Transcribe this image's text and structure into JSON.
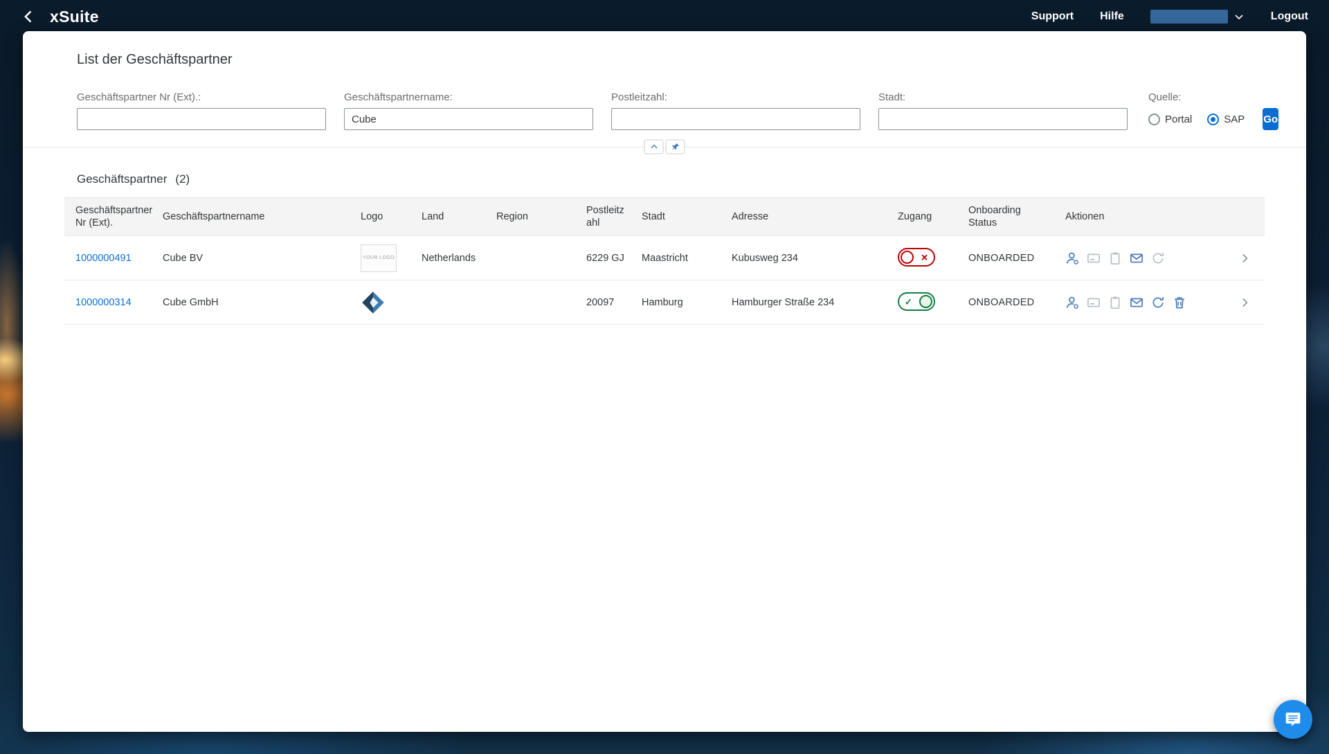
{
  "topbar": {
    "logo": "xSuite",
    "support_label": "Support",
    "hilfe_label": "Hilfe",
    "logout_label": "Logout"
  },
  "header": {
    "title": "List der Geschäftspartner"
  },
  "filters": {
    "fields": [
      {
        "label": "Geschäftspartner Nr (Ext).:",
        "value": ""
      },
      {
        "label": "Geschäftspartnername:",
        "value": "Cube"
      },
      {
        "label": "Postleitzahl:",
        "value": ""
      },
      {
        "label": "Stadt:",
        "value": ""
      }
    ],
    "quelle": {
      "label": "Quelle:",
      "options": [
        {
          "label": "Portal",
          "selected": false
        },
        {
          "label": "SAP",
          "selected": true
        }
      ],
      "selected": "SAP"
    },
    "go_label": "Go"
  },
  "table": {
    "section_title": "Geschäftspartner",
    "count": "(2)",
    "columns": [
      "Geschäftspartner Nr (Ext).",
      "Geschäftspartnername",
      "Logo",
      "Land",
      "Region",
      "Postleitzahl",
      "Stadt",
      "Adresse",
      "Zugang",
      "Onboarding Status",
      "Aktionen"
    ],
    "rows": [
      {
        "nr": "1000000491",
        "name": "Cube BV",
        "logo_text": "YOUR LOGO",
        "land": "Netherlands",
        "region": "",
        "plz": "6229 GJ",
        "stadt": "Maastricht",
        "adresse": "Kubusweg 234",
        "zugang_state": "off",
        "status": "ONBOARDED"
      },
      {
        "nr": "1000000314",
        "name": "Cube GmbH",
        "logo_text": "",
        "land": "",
        "region": "",
        "plz": "20097",
        "stadt": "Hamburg",
        "adresse": "Hamburger Straße 234",
        "zugang_state": "on",
        "status": "ONBOARDED"
      }
    ]
  },
  "colors": {
    "accent": "#0a6ed1",
    "success": "#107e3e",
    "error": "#bb0000",
    "topbar_bg": "#0a1b2b",
    "icon_blue": "#4a7ebb"
  }
}
